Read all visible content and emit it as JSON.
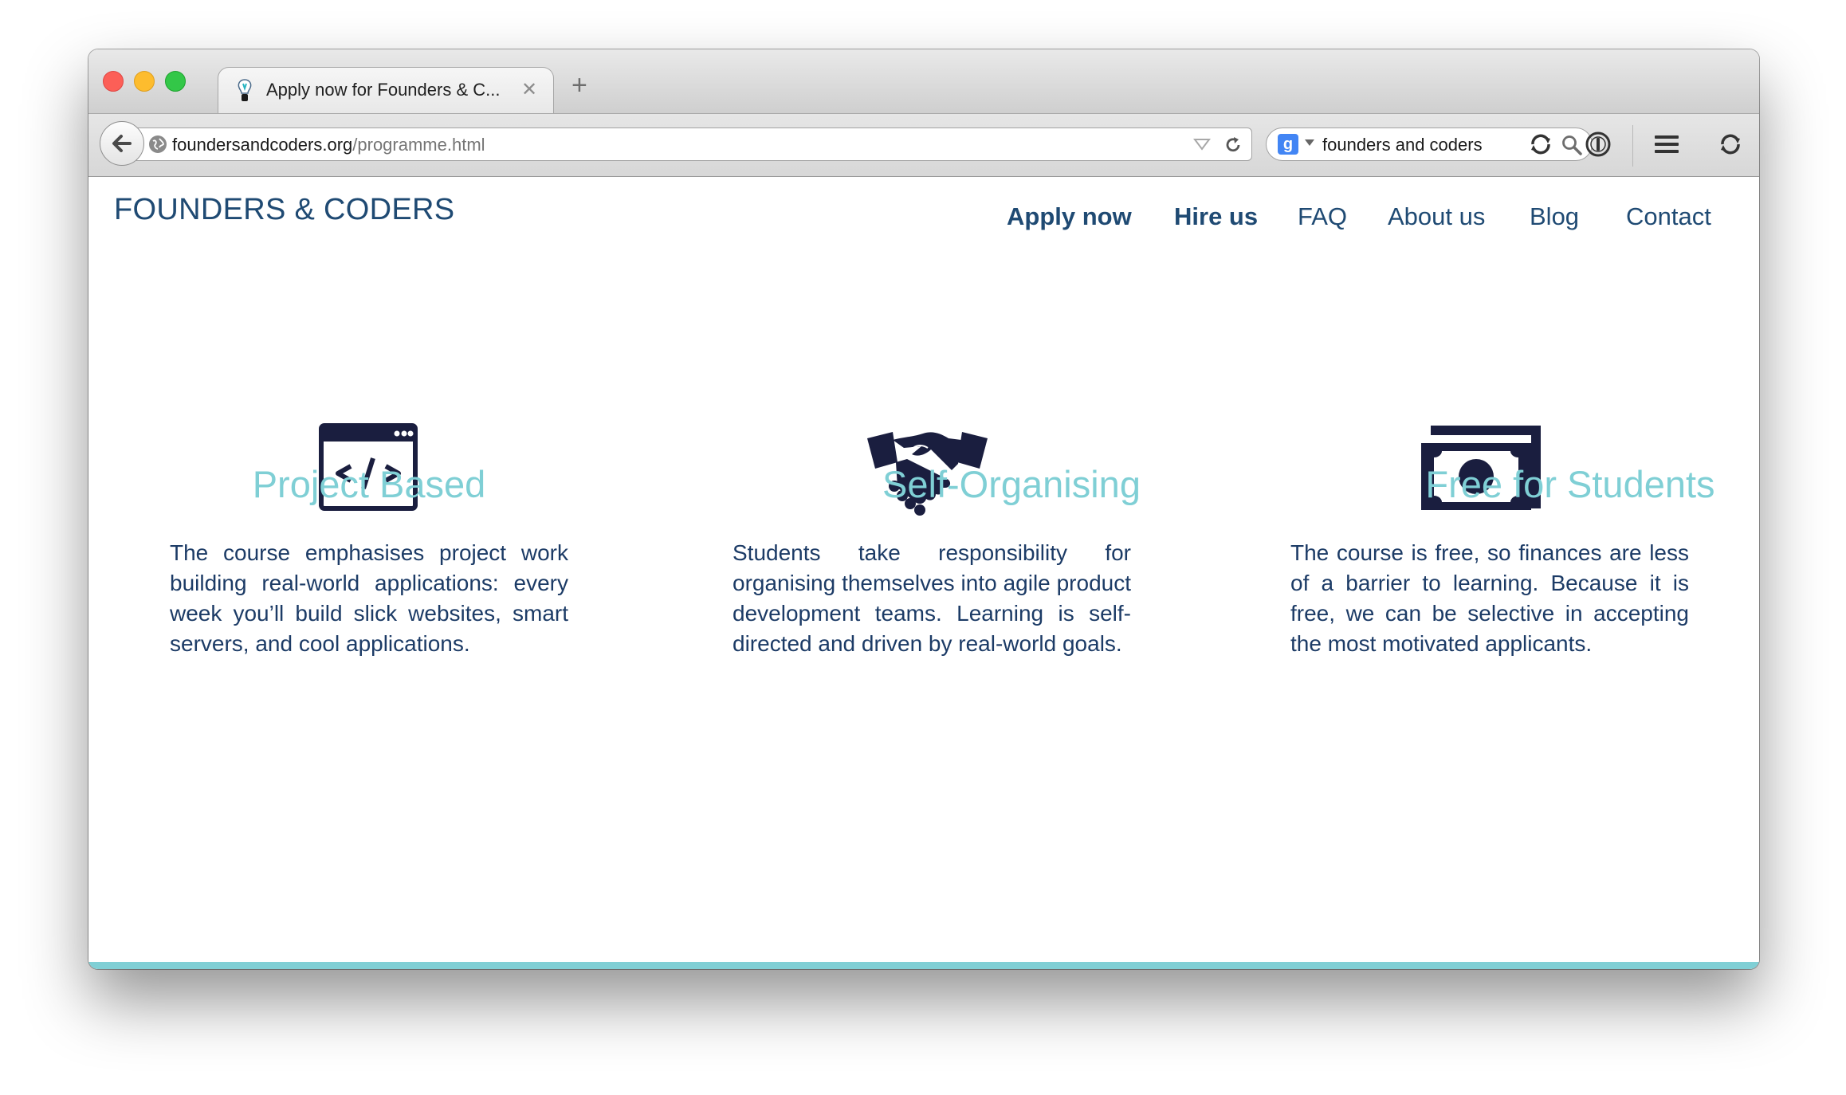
{
  "browser": {
    "tab": {
      "title": "Apply now for Founders & C...",
      "close": "✕"
    },
    "new_tab_label": "+",
    "url": {
      "host": "foundersandcoders.org",
      "path": "/programme.html"
    },
    "search": {
      "engine_letter": "g",
      "query": "founders and coders"
    }
  },
  "site": {
    "brand": "FOUNDERS & CODERS",
    "nav": [
      {
        "label": "Apply now",
        "bold": true
      },
      {
        "label": "Hire us",
        "bold": true
      },
      {
        "label": "FAQ",
        "bold": false
      },
      {
        "label": "About us",
        "bold": false
      },
      {
        "label": "Blog",
        "bold": false
      },
      {
        "label": "Contact",
        "bold": false
      }
    ],
    "features": [
      {
        "icon": "code-window-icon",
        "title": "Project Based",
        "body": "The course emphasises project work building real-world applications: every week you’ll build slick websites, smart servers, and cool applications."
      },
      {
        "icon": "handshake-icon",
        "title": "Self-Organising",
        "body": "Students take responsibility for organising themselves into agile product development teams. Learning is self-directed and driven by real-world goals."
      },
      {
        "icon": "money-icon",
        "title": "Free for Students",
        "body": "The course is free, so finances are less of a barrier to learning. Because it is free, we can be selective in accepting the most motivated applicants."
      }
    ]
  },
  "colors": {
    "brand_navy": "#1f4a73",
    "feature_title": "#7fcfd5",
    "body_text": "#1c3b66",
    "icon": "#1a1e3f",
    "footer_band": "#80cfd5"
  }
}
